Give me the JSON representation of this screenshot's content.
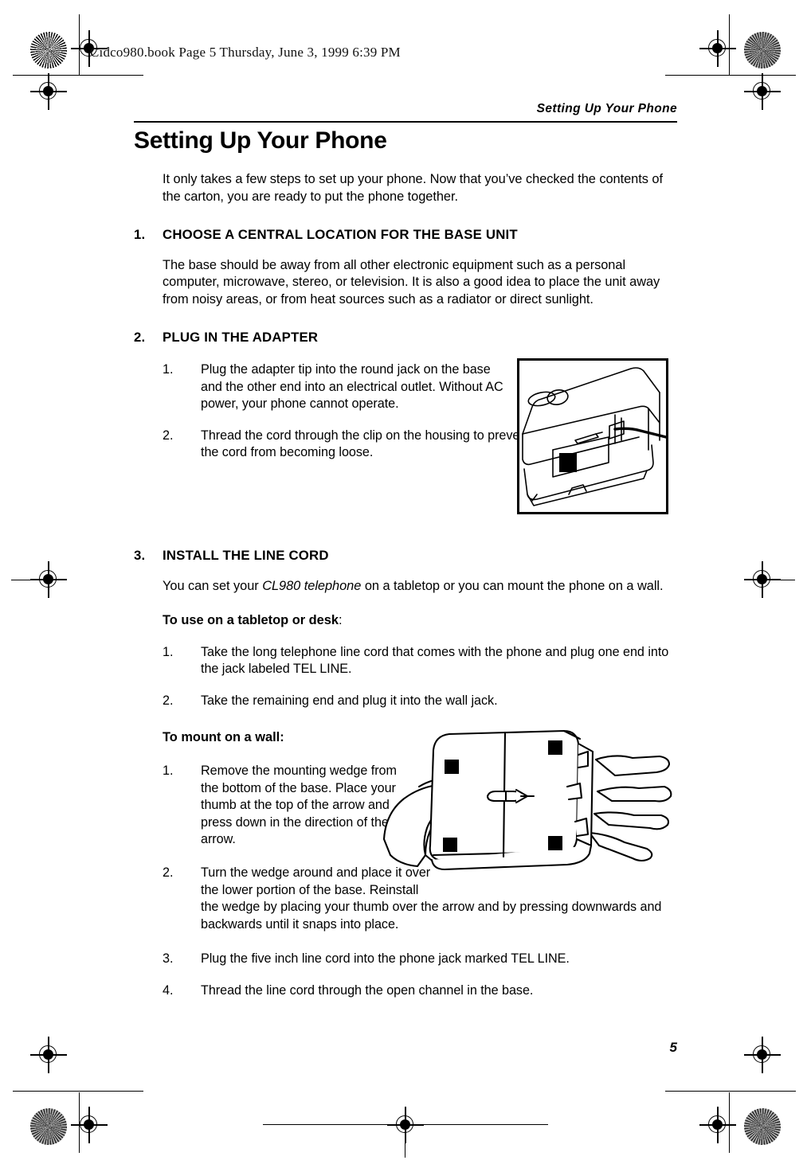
{
  "header": {
    "file_stamp": "Cidco980.book  Page 5  Thursday, June 3, 1999  6:39 PM",
    "running_head": "Setting Up Your Phone"
  },
  "title": "Setting Up Your Phone",
  "intro": "It only takes a few steps to set up your phone. Now that you’ve checked the contents of the carton, you are ready to put the phone together.",
  "steps": [
    {
      "number": "1.",
      "heading": "CHOOSE A CENTRAL LOCATION FOR THE BASE UNIT",
      "paragraph": "The base should be away from all other electronic equipment such as a personal computer, microwave, stereo, or television. It is also a good idea to place the unit away from noisy areas, or from heat sources such as a radiator or direct sunlight."
    },
    {
      "number": "2.",
      "heading": "PLUG IN THE ADAPTER",
      "items": [
        {
          "marker": "1.",
          "text": "Plug the adapter tip into the round jack on the base and the other end into an electrical outlet. Without AC power, your phone cannot operate."
        },
        {
          "marker": "2.",
          "text": "Thread the cord through the clip on the housing to prevent the cord from becoming loose."
        }
      ]
    },
    {
      "number": "3.",
      "heading": "INSTALL THE LINE CORD",
      "lead_before": "You can set your ",
      "lead_italic": "CL980 telephone",
      "lead_after": " on a tabletop or you can mount the phone on a wall.",
      "subhead_tabletop": "To use on a tabletop or desk",
      "subhead_tabletop_colon": ":",
      "tabletop_items": [
        {
          "marker": "1.",
          "text": "Take the long telephone line cord that comes with the phone and plug one end into the jack labeled TEL LINE."
        },
        {
          "marker": "2.",
          "text": "Take the remaining end and plug it into the wall jack."
        }
      ],
      "subhead_wall": "To mount on a wall:",
      "wall_items": [
        {
          "marker": "1.",
          "text": "Remove the mounting wedge from the bottom of the base. Place your thumb at the top of the arrow and press down in the direction of the arrow."
        },
        {
          "marker": "2.",
          "text_narrow": "Turn the wedge around and place it over the lower portion of the base. Reinstall",
          "text_wide": " the wedge by placing your thumb over the arrow and by pressing downwards and backwards until it snaps into place."
        },
        {
          "marker": "3.",
          "text": "Plug the five inch line cord into the phone jack marked TEL LINE."
        },
        {
          "marker": "4.",
          "text": "Thread the line cord through the open channel in the base."
        }
      ]
    }
  ],
  "figures": {
    "base_unit": "phone-base-cord-clip-illustration",
    "wall_mount": "hands-removing-mounting-wedge-illustration"
  },
  "page_number": "5",
  "colors": {
    "ink": "#000000",
    "paper": "#ffffff"
  }
}
